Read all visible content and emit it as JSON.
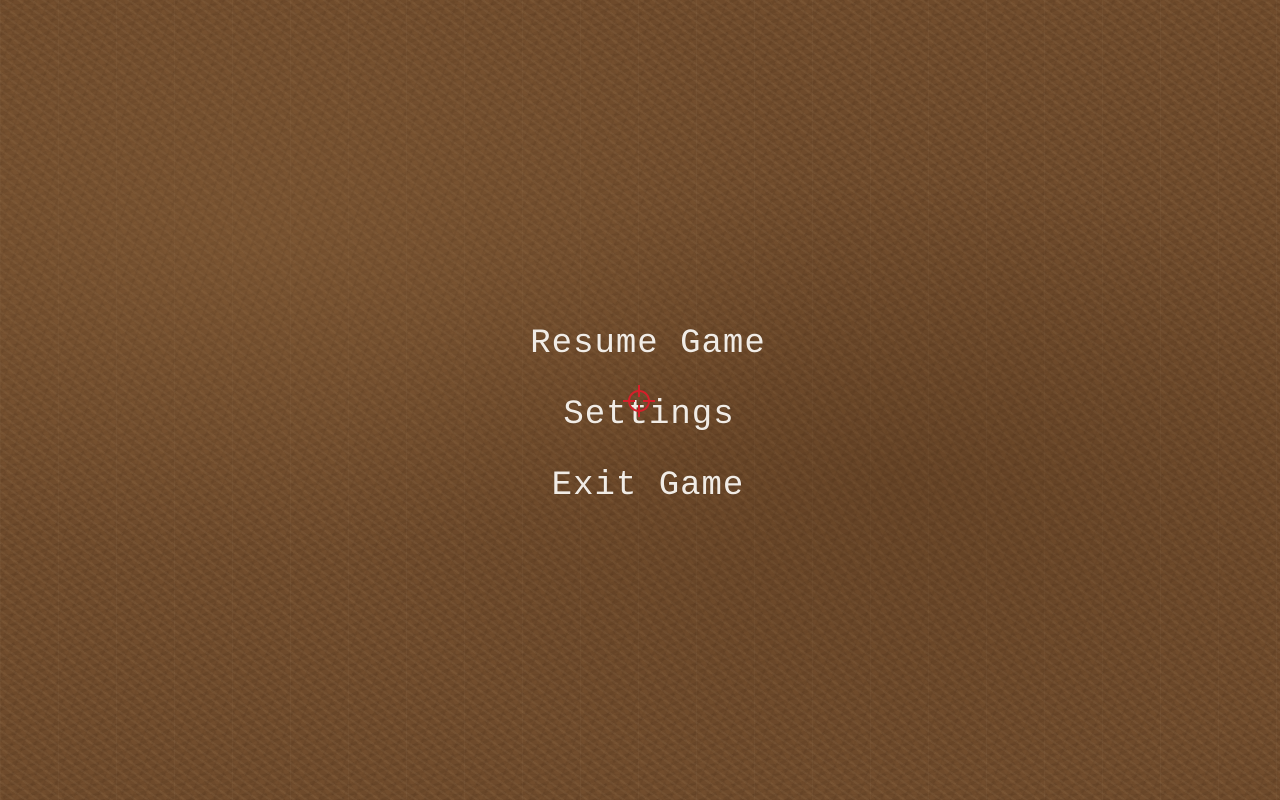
{
  "menu": {
    "resume_label": "Resume Game",
    "settings_label": "Settings",
    "exit_label": "Exit Game"
  },
  "cursor": {
    "icon": "crosshair-icon",
    "color": "#d61f2a"
  },
  "colors": {
    "background": "#6e4a2b",
    "menu_text": "#f1ece6"
  }
}
